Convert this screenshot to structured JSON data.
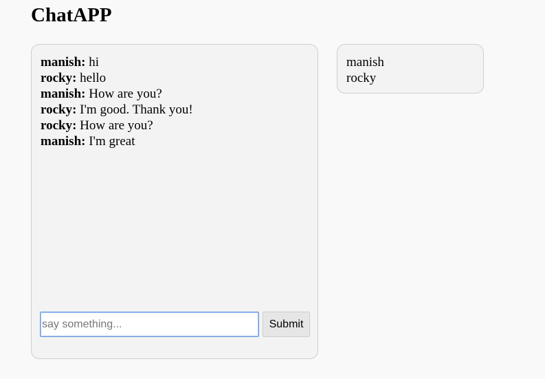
{
  "app": {
    "title": "ChatAPP"
  },
  "chat": {
    "messages": [
      {
        "user": "manish:",
        "text": "hi"
      },
      {
        "user": "rocky:",
        "text": "hello"
      },
      {
        "user": "manish:",
        "text": "How are you?"
      },
      {
        "user": "rocky:",
        "text": "I'm good. Thank you!"
      },
      {
        "user": "rocky:",
        "text": "How are you?"
      },
      {
        "user": "manish:",
        "text": "I'm great"
      }
    ],
    "input": {
      "value": "",
      "placeholder": "say something..."
    },
    "submit_label": "Submit"
  },
  "users": {
    "items": [
      "manish",
      "rocky"
    ]
  },
  "colors": {
    "page_background": "#f9f9f9",
    "panel_background": "#f3f3f3",
    "panel_border": "#cfcfcf",
    "input_focus_border": "#6f9fe0",
    "button_background": "#e6e6e6"
  }
}
